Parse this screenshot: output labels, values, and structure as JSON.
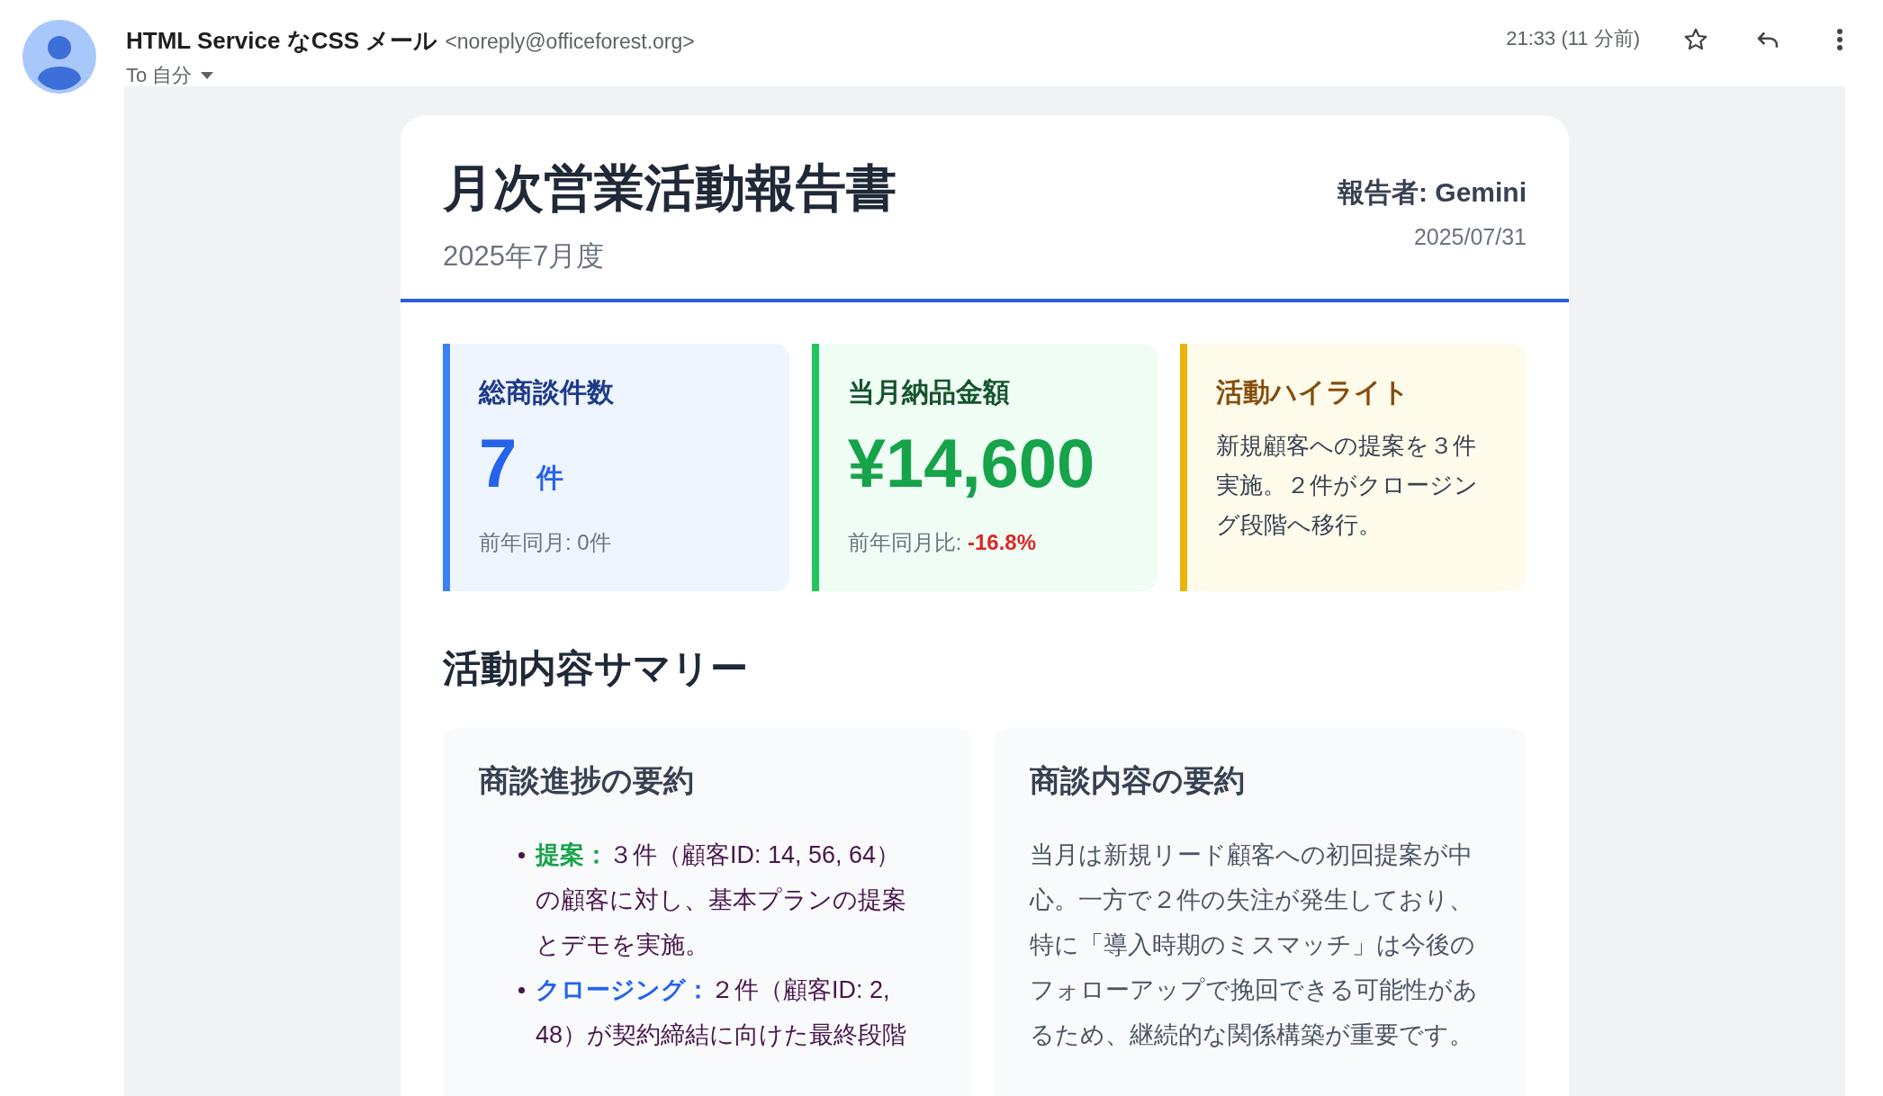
{
  "email": {
    "sender_name": "HTML Service なCSS メール",
    "sender_address": "<noreply@officeforest.org>",
    "recipient": "To 自分",
    "time": "21:33 (11 分前)"
  },
  "report": {
    "title": "月次営業活動報告書",
    "period": "2025年7月度",
    "reporter": "報告者: Gemini",
    "date": "2025/07/31",
    "stats": [
      {
        "kind": "count",
        "title": "総商談件数",
        "value": "7",
        "unit": "件",
        "note": "前年同月: 0件"
      },
      {
        "kind": "amount",
        "title": "当月納品金額",
        "value": "¥14,600",
        "note": "前年同月比: ",
        "delta": "-16.8%"
      },
      {
        "kind": "highlight",
        "title": "活動ハイライト",
        "text": "新規顧客への提案を３件実施。２件がクロージング段階へ移行。"
      }
    ],
    "summary_heading": "活動内容サマリー",
    "progress": {
      "title": "商談進捗の要約",
      "items": [
        {
          "label": "提案：",
          "color": "#16a34a",
          "text": "３件（顧客ID: 14, 56, 64）の顧客に対し、基本プランの提案とデモを実施。"
        },
        {
          "label": "クロージング：",
          "color": "#2563eb",
          "text": "２件（顧客ID: 2, 48）が契約締結に向けた最終段階"
        }
      ]
    },
    "content": {
      "title": "商談内容の要約",
      "text": "当月は新規リード顧客への初回提案が中心。一方で２件の失注が発生しており、特に「導入時期のミスマッチ」は今後のフォローアップで挽回できる可能性があるため、継続的な関係構築が重要です。"
    }
  }
}
